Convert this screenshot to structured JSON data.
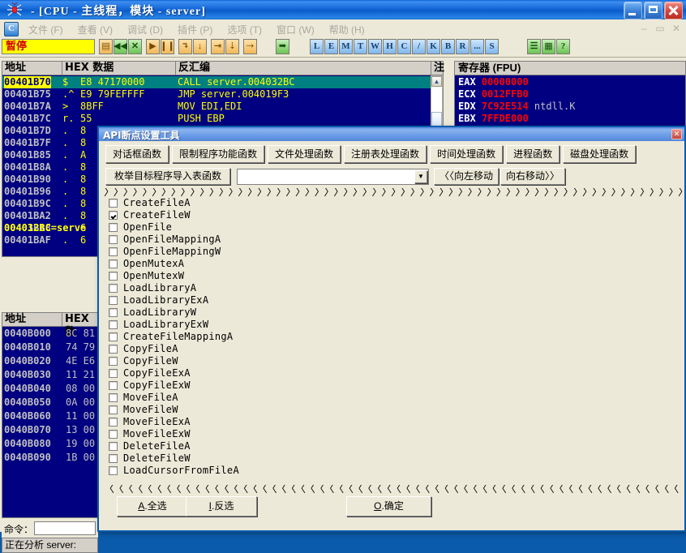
{
  "window": {
    "title": "- [CPU -  主线程，模块 - server]",
    "icon": "olly-bug-icon",
    "buttons": {
      "minimize": "–",
      "maximize": "□",
      "close": "✕"
    }
  },
  "menubar": {
    "items": [
      "文件 (F)",
      "查看 (V)",
      "调试 (D)",
      "插件 (P)",
      "选项 (T)",
      "窗口 (W)",
      "帮助 (H)"
    ],
    "mdi_controls": [
      "–",
      "▭",
      "✕"
    ]
  },
  "toolbar": {
    "run_state": "暂停",
    "icon_buttons": [
      "open",
      "restart",
      "close",
      "run",
      "pause",
      "step-into",
      "step-over",
      "trace-into",
      "trace-over",
      "execute-till-return",
      "run-to-cursor"
    ],
    "letter_buttons": [
      "L",
      "E",
      "M",
      "T",
      "W",
      "H",
      "C",
      "/",
      "K",
      "B",
      "R",
      "...",
      "S"
    ],
    "end_buttons": [
      "list",
      "colors",
      "?"
    ]
  },
  "cpu": {
    "disasm": {
      "headers": [
        "地址",
        "HEX 数据",
        "反汇编",
        "注"
      ],
      "rows": [
        {
          "address": "00401B70",
          "mark": "$",
          "hex": "E8 47170000",
          "asm": "CALL server.004032BC",
          "selected": true
        },
        {
          "address": "00401B75",
          "mark": ".^",
          "hex": "E9 79FEFFFF",
          "asm": "JMP server.004019F3",
          "selected": false
        },
        {
          "address": "00401B7A",
          "mark": ">",
          "hex": "8BFF",
          "asm": "MOV EDI,EDI",
          "selected": false
        },
        {
          "address": "00401B7C",
          "mark": "r.",
          "hex": "55",
          "asm": "PUSH EBP",
          "selected": false
        },
        {
          "address": "00401B7D",
          "mark": ".",
          "hex": "8",
          "asm": "",
          "selected": false
        },
        {
          "address": "00401B7F",
          "mark": ".",
          "hex": "8",
          "asm": "",
          "selected": false
        },
        {
          "address": "00401B85",
          "mark": ".",
          "hex": "A",
          "asm": "",
          "selected": false
        },
        {
          "address": "00401B8A",
          "mark": ".",
          "hex": "8",
          "asm": "",
          "selected": false
        },
        {
          "address": "00401B90",
          "mark": ".",
          "hex": "8",
          "asm": "",
          "selected": false
        },
        {
          "address": "00401B96",
          "mark": ".",
          "hex": "8",
          "asm": "",
          "selected": false
        },
        {
          "address": "00401B9C",
          "mark": ".",
          "hex": "8",
          "asm": "",
          "selected": false
        },
        {
          "address": "00401BA2",
          "mark": ".",
          "hex": "8",
          "asm": "",
          "selected": false
        },
        {
          "address": "00401BA8",
          "mark": ".",
          "hex": "6",
          "asm": "",
          "selected": false
        },
        {
          "address": "00401BAF",
          "mark": ".",
          "hex": "6",
          "asm": "",
          "selected": false
        }
      ],
      "hint": "004032BC=serve"
    },
    "registers": {
      "title": "寄存器 (FPU)",
      "rows": [
        {
          "name": "EAX",
          "value": "00000000",
          "comment": ""
        },
        {
          "name": "ECX",
          "value": "0012FFB0",
          "comment": ""
        },
        {
          "name": "EDX",
          "value": "7C92E514",
          "comment": "ntdll.K"
        },
        {
          "name": "EBX",
          "value": "7FFDE000",
          "comment": ""
        }
      ]
    },
    "dump": {
      "headers": [
        "地址",
        "HEX 数"
      ],
      "rows": [
        {
          "address": "0040B000",
          "hex": "8C 81"
        },
        {
          "address": "0040B010",
          "hex": "74 79"
        },
        {
          "address": "0040B020",
          "hex": "4E E6"
        },
        {
          "address": "0040B030",
          "hex": "11 21"
        },
        {
          "address": "0040B040",
          "hex": "08 00"
        },
        {
          "address": "0040B050",
          "hex": "0A 00"
        },
        {
          "address": "0040B060",
          "hex": "11 00"
        },
        {
          "address": "0040B070",
          "hex": "13 00"
        },
        {
          "address": "0040B080",
          "hex": "19 00"
        },
        {
          "address": "0040B090",
          "hex": "1B 00"
        }
      ]
    },
    "command": {
      "label": "命令：",
      "value": ""
    },
    "status": "正在分析 server:"
  },
  "dialog": {
    "title": "API断点设置工具",
    "close_label": "✕",
    "tabs": [
      {
        "label": "对话框函数",
        "active": false
      },
      {
        "label": "限制程序功能函数",
        "active": false
      },
      {
        "label": "文件处理函数",
        "active": true
      },
      {
        "label": "注册表处理函数",
        "active": false
      },
      {
        "label": "时间处理函数",
        "active": false
      },
      {
        "label": "进程函数",
        "active": false
      },
      {
        "label": "磁盘处理函数",
        "active": false
      }
    ],
    "enum_button": "枚举目标程序导入表函数",
    "combo": {
      "value": "",
      "arrow": "▼"
    },
    "move_left": "〈〈向左移动",
    "move_right": "向右移动〉〉",
    "functions": [
      {
        "name": "CreateFileA",
        "checked": false
      },
      {
        "name": "CreateFileW",
        "checked": true
      },
      {
        "name": "OpenFile",
        "checked": false
      },
      {
        "name": "OpenFileMappingA",
        "checked": false
      },
      {
        "name": "OpenFileMappingW",
        "checked": false
      },
      {
        "name": "OpenMutexA",
        "checked": false
      },
      {
        "name": "OpenMutexW",
        "checked": false
      },
      {
        "name": "LoadLibraryA",
        "checked": false
      },
      {
        "name": "LoadLibraryExA",
        "checked": false
      },
      {
        "name": "LoadLibraryW",
        "checked": false
      },
      {
        "name": "LoadLibraryExW",
        "checked": false
      },
      {
        "name": "CreateFileMappingA",
        "checked": false
      },
      {
        "name": "CopyFileA",
        "checked": false
      },
      {
        "name": "CopyFileW",
        "checked": false
      },
      {
        "name": "CopyFileExA",
        "checked": false
      },
      {
        "name": "CopyFileExW",
        "checked": false
      },
      {
        "name": "MoveFileA",
        "checked": false
      },
      {
        "name": "MoveFileW",
        "checked": false
      },
      {
        "name": "MoveFileExA",
        "checked": false
      },
      {
        "name": "MoveFileExW",
        "checked": false
      },
      {
        "name": "DeleteFileA",
        "checked": false
      },
      {
        "name": "DeleteFileW",
        "checked": false
      },
      {
        "name": "LoadCursorFromFileA",
        "checked": false
      }
    ],
    "buttons": {
      "select_all": "A.全选",
      "invert": "I.反选",
      "ok": "O.确定"
    }
  },
  "colors": {
    "desktop": "#0a5bab",
    "panel_bg": "#000080",
    "face": "#ece9d8",
    "accent_yellow": "#ffff00",
    "accent_red": "#ff0000",
    "selection": "#008080"
  }
}
